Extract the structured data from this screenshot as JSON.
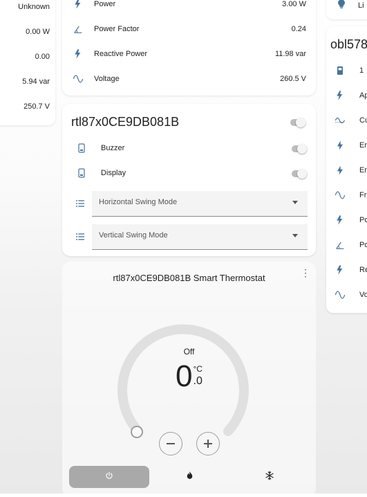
{
  "left_card": {
    "values": [
      "Unknown",
      "0.00 W",
      "0.00",
      "5.94 var",
      "250.7 V"
    ]
  },
  "middle_top_card": {
    "rows": [
      {
        "icon": "lightning-icon",
        "label": "Power",
        "value": "3.00 W"
      },
      {
        "icon": "angle-icon",
        "label": "Power Factor",
        "value": "0.24"
      },
      {
        "icon": "lightning-icon",
        "label": "Reactive Power",
        "value": "11.98 var"
      },
      {
        "icon": "sine-wave-icon",
        "label": "Voltage",
        "value": "260.5 V"
      }
    ]
  },
  "device_card": {
    "title": "rtl87x0CE9DB081B",
    "rows": [
      {
        "icon": "tablet-icon",
        "label": "Buzzer"
      },
      {
        "icon": "tablet-icon",
        "label": "Display"
      }
    ],
    "selects": [
      {
        "icon": "list-icon",
        "placeholder": "Horizontal Swing Mode"
      },
      {
        "icon": "list-icon",
        "placeholder": "Vertical Swing Mode"
      }
    ]
  },
  "thermostat": {
    "title": "rtl87x0CE9DB081B Smart Thermostat",
    "state": "Off",
    "temp_int": "0",
    "temp_unit": "°C",
    "temp_dec": ".0",
    "modes": [
      {
        "name": "power",
        "icon": "power-icon",
        "active": true
      },
      {
        "name": "heat",
        "icon": "flame-icon",
        "active": false
      },
      {
        "name": "cool",
        "icon": "snowflake-icon",
        "active": false
      }
    ]
  },
  "right_card": {
    "top_label": "Li",
    "title": "obl578",
    "rows": [
      {
        "icon": "battery-icon",
        "label": "1"
      },
      {
        "icon": "lightning-icon",
        "label": "Ap"
      },
      {
        "icon": "current-ac-icon",
        "label": "Cu"
      },
      {
        "icon": "flash-icon",
        "label": "En"
      },
      {
        "icon": "flash-icon",
        "label": "En"
      },
      {
        "icon": "sine-wave-icon",
        "label": "Fr"
      },
      {
        "icon": "lightning-icon",
        "label": "Po"
      },
      {
        "icon": "angle-icon",
        "label": "Po"
      },
      {
        "icon": "lightning-icon",
        "label": "Re"
      },
      {
        "icon": "sine-wave-icon",
        "label": "Vo"
      }
    ]
  },
  "colors": {
    "icon": "#44739e",
    "card": "#ffffff",
    "mode_active": "#a9a9a9",
    "toggle_track": "#bdbdbd"
  }
}
